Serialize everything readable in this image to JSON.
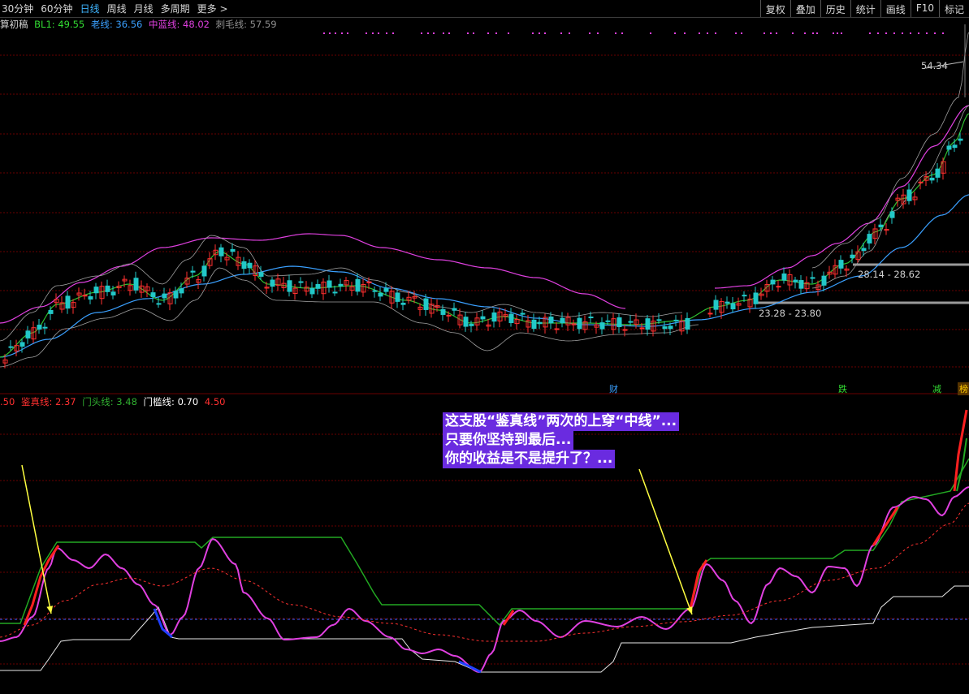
{
  "toolbar": {
    "periods": [
      "30分钟",
      "60分钟",
      "日线",
      "周线",
      "月线",
      "多周期",
      "更多 >"
    ],
    "active_period": "日线",
    "actions": [
      "复权",
      "叠加",
      "历史",
      "统计",
      "画线",
      "F10",
      "标记"
    ]
  },
  "main_legend": {
    "title": "算初稿",
    "bl1": "BL1: 49.55",
    "laoxian": "老线: 36.56",
    "zhonglan": "中蓝线: 48.02",
    "cimao": "刺毛线: 57.59"
  },
  "sub_legend": {
    "lead": ".50",
    "jianzhen": "鉴真线: 2.37",
    "mentou": "门头线: 3.48",
    "menkan": "门槛线: 0.70",
    "extra": "4.50"
  },
  "price_labels": {
    "high": "54.34",
    "zone1": "28.14 - 28.62",
    "zone2": "23.28 - 23.80"
  },
  "events": {
    "cai": "财",
    "die": "跌",
    "jian": "减",
    "bang": "榜"
  },
  "annotation": {
    "line1": "这支股“鉴真线”两次的上穿“中线”...",
    "line2": "只要你坚持到最后...",
    "line3": "你的收益是不是提升了？..."
  },
  "colors": {
    "up": "#ff3030",
    "down": "#22c8c8",
    "magenta": "#e040e0",
    "blue_line": "#3aa0ff",
    "green_line": "#30b030",
    "grid": "#7a0000",
    "arrow": "#ffff40"
  }
}
